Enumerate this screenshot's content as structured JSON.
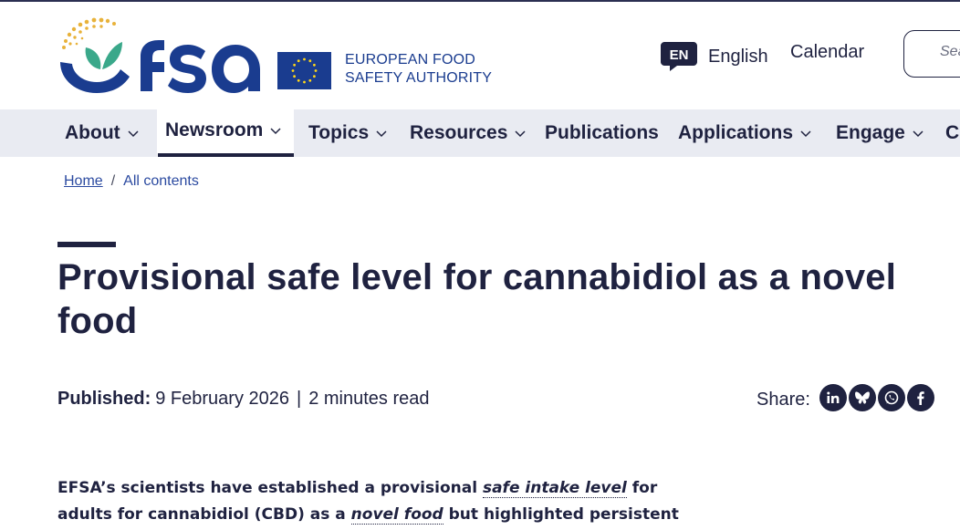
{
  "header": {
    "logo_text": "efsa",
    "authority_line1": "EUROPEAN FOOD",
    "authority_line2": "SAFETY AUTHORITY",
    "language_code": "EN",
    "language_label": "English",
    "calendar_label": "Calendar",
    "search_placeholder": "Sea"
  },
  "nav": {
    "items": [
      {
        "label": "About",
        "has_dropdown": true
      },
      {
        "label": "Newsroom",
        "has_dropdown": true,
        "active": true
      },
      {
        "label": "Topics",
        "has_dropdown": true
      },
      {
        "label": "Resources",
        "has_dropdown": true
      },
      {
        "label": "Publications",
        "has_dropdown": false
      },
      {
        "label": "Applications",
        "has_dropdown": true
      },
      {
        "label": "Engage",
        "has_dropdown": true
      },
      {
        "label": "C",
        "has_dropdown": false
      }
    ]
  },
  "breadcrumb": {
    "home": "Home",
    "separator": "/",
    "current": "All contents"
  },
  "article": {
    "title": "Provisional safe level for cannabidiol as a novel food",
    "published_label": "Published:",
    "published_date": "9 February 2026",
    "meta_separator": "|",
    "read_time": "2 minutes read",
    "share_label": "Share:",
    "share_icons": [
      "linkedin-icon",
      "bluesky-icon",
      "whatsapp-icon",
      "facebook-icon"
    ],
    "lead_part1": "EFSA’s scientists have established a provisional ",
    "lead_link1": "safe intake level",
    "lead_part2": " for adults for cannabidiol (CBD) as a ",
    "lead_link2": "novel food",
    "lead_part3": " but highlighted persistent data gaps."
  },
  "colors": {
    "brand_navy": "#1f2240",
    "brand_blue": "#1a3c8f",
    "logo_green": "#3aa88a",
    "logo_gold": "#e8b23a",
    "nav_bg": "#e9ebf2",
    "link_blue": "#2b4aa0"
  }
}
